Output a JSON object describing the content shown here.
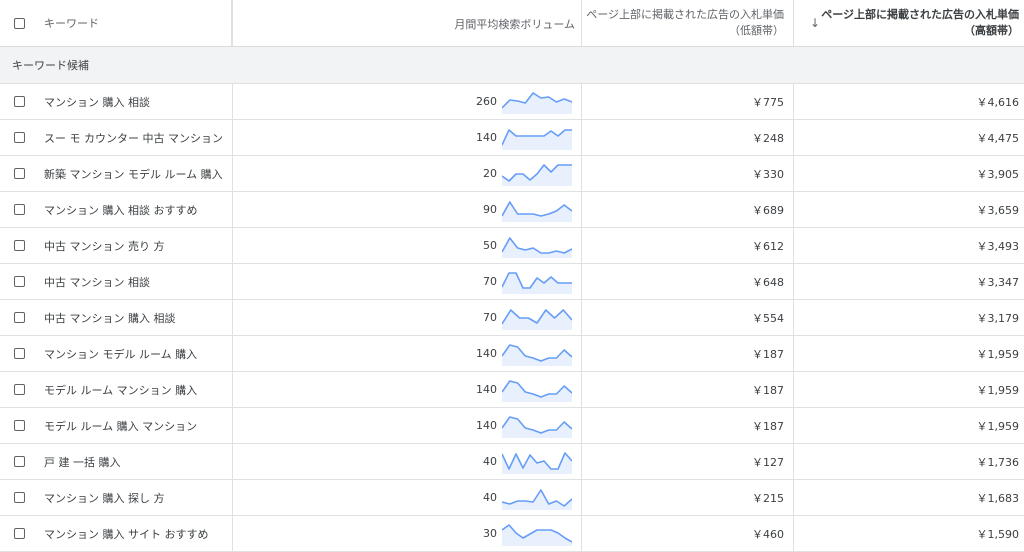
{
  "header": {
    "keyword": "キーワード",
    "volume": "月間平均検索ボリューム",
    "low_bid_line1": "ページ上部に掲載された広告の入札単価",
    "low_bid_line2": "（低額帯）",
    "high_bid_line1": "ページ上部に掲載された広告の入札単価",
    "high_bid_line2": "（高額帯）",
    "sort_icon": "arrow-down-icon"
  },
  "group_label": "キーワード候補",
  "colors": {
    "spark_line": "#669df6",
    "spark_fill": "#e8f0fe"
  },
  "rows": [
    {
      "keyword": "マンション 購入 相談",
      "volume": "260",
      "low": "￥775",
      "high": "￥4,616",
      "trend": [
        0.2,
        0.6,
        0.55,
        0.45,
        0.95,
        0.7,
        0.75,
        0.5,
        0.65,
        0.5
      ]
    },
    {
      "keyword": "スー モ カウンター 中古 マンション",
      "volume": "140",
      "low": "￥248",
      "high": "￥4,475",
      "trend": [
        0.15,
        0.9,
        0.6,
        0.6,
        0.6,
        0.6,
        0.6,
        0.85,
        0.6,
        0.9,
        0.9
      ]
    },
    {
      "keyword": "新築 マンション モデル ルーム 購入",
      "volume": "20",
      "low": "￥330",
      "high": "￥3,905",
      "trend": [
        0.4,
        0.15,
        0.5,
        0.5,
        0.2,
        0.5,
        0.95,
        0.6,
        0.95,
        0.95,
        0.95
      ]
    },
    {
      "keyword": "マンション 購入 相談 おすすめ",
      "volume": "90",
      "low": "￥689",
      "high": "￥3,659",
      "trend": [
        0.2,
        0.9,
        0.3,
        0.3,
        0.3,
        0.2,
        0.3,
        0.45,
        0.75,
        0.45
      ]
    },
    {
      "keyword": "中古 マンション 売り 方",
      "volume": "50",
      "low": "￥612",
      "high": "￥3,493",
      "trend": [
        0.2,
        0.9,
        0.4,
        0.3,
        0.4,
        0.15,
        0.15,
        0.25,
        0.15,
        0.35
      ]
    },
    {
      "keyword": "中古 マンション 相談",
      "volume": "70",
      "low": "￥648",
      "high": "￥3,347",
      "trend": [
        0.25,
        0.95,
        0.95,
        0.2,
        0.2,
        0.7,
        0.45,
        0.75,
        0.45,
        0.45,
        0.45
      ]
    },
    {
      "keyword": "中古 マンション 購入 相談",
      "volume": "70",
      "low": "￥554",
      "high": "￥3,179",
      "trend": [
        0.2,
        0.9,
        0.5,
        0.5,
        0.25,
        0.9,
        0.5,
        0.9,
        0.4
      ]
    },
    {
      "keyword": "マンション モデル ルーム 購入",
      "volume": "140",
      "low": "￥187",
      "high": "￥1,959",
      "trend": [
        0.4,
        0.95,
        0.85,
        0.4,
        0.3,
        0.15,
        0.3,
        0.3,
        0.7,
        0.35
      ]
    },
    {
      "keyword": "モデル ルーム マンション 購入",
      "volume": "140",
      "low": "￥187",
      "high": "￥1,959",
      "trend": [
        0.4,
        0.95,
        0.85,
        0.4,
        0.3,
        0.15,
        0.3,
        0.3,
        0.7,
        0.35
      ]
    },
    {
      "keyword": "モデル ルーム 購入 マンション",
      "volume": "140",
      "low": "￥187",
      "high": "￥1,959",
      "trend": [
        0.4,
        0.95,
        0.85,
        0.4,
        0.3,
        0.15,
        0.3,
        0.3,
        0.7,
        0.35
      ]
    },
    {
      "keyword": "戸 建 一括 購入",
      "volume": "40",
      "low": "￥127",
      "high": "￥1,736",
      "trend": [
        0.9,
        0.15,
        0.9,
        0.2,
        0.85,
        0.45,
        0.55,
        0.15,
        0.15,
        0.95,
        0.55
      ]
    },
    {
      "keyword": "マンション 購入 探し 方",
      "volume": "40",
      "low": "￥215",
      "high": "￥1,683",
      "trend": [
        0.3,
        0.2,
        0.35,
        0.35,
        0.3,
        0.9,
        0.2,
        0.35,
        0.1,
        0.45
      ]
    },
    {
      "keyword": "マンション 購入 サイト おすすめ",
      "volume": "30",
      "low": "￥460",
      "high": "￥1,590",
      "trend": [
        0.7,
        0.95,
        0.55,
        0.3,
        0.5,
        0.7,
        0.7,
        0.7,
        0.55,
        0.3,
        0.1
      ]
    }
  ]
}
